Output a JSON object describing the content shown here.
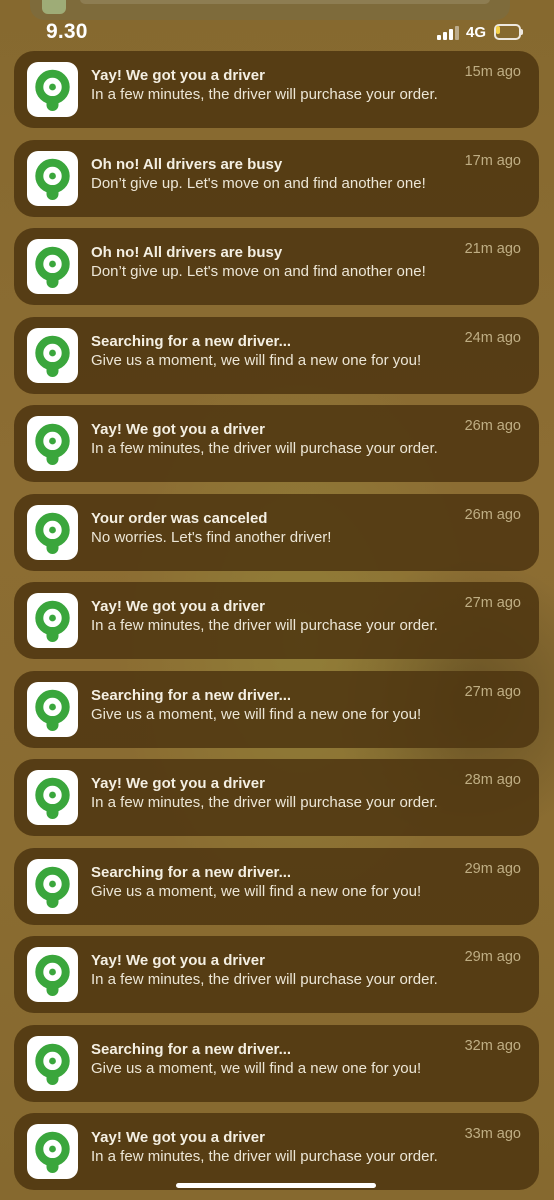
{
  "status_bar": {
    "time": "9.30",
    "network": "4G",
    "signal_bars": 3,
    "battery_level": 0.2,
    "battery_color": "#f4d14a"
  },
  "app": {
    "icon": "gojek-ring-icon",
    "icon_color": "#3aa63c"
  },
  "notifications": [
    {
      "title": "Yay! We got you a driver",
      "body": "In a few minutes, the driver will purchase your order.",
      "time": "15m ago"
    },
    {
      "title": "Oh no! All drivers are busy",
      "body": "Don’t give up. Let's move on and find another one!",
      "time": "17m ago"
    },
    {
      "title": "Oh no! All drivers are busy",
      "body": "Don’t give up. Let's move on and find another one!",
      "time": "21m ago"
    },
    {
      "title": "Searching for a new driver...",
      "body": "Give us a moment, we will find a new one for you!",
      "time": "24m ago"
    },
    {
      "title": "Yay! We got you a driver",
      "body": "In a few minutes, the driver will purchase your order.",
      "time": "26m ago"
    },
    {
      "title": "Your order was canceled",
      "body": "No worries. Let's find another driver!",
      "time": "26m ago"
    },
    {
      "title": "Yay! We got you a driver",
      "body": "In a few minutes, the driver will purchase your order.",
      "time": "27m ago"
    },
    {
      "title": "Searching for a new driver...",
      "body": "Give us a moment, we will find a new one for you!",
      "time": "27m ago"
    },
    {
      "title": "Yay! We got you a driver",
      "body": "In a few minutes, the driver will purchase your order.",
      "time": "28m ago"
    },
    {
      "title": "Searching for a new driver...",
      "body": "Give us a moment, we will find a new one for you!",
      "time": "29m ago"
    },
    {
      "title": "Yay! We got you a driver",
      "body": "In a few minutes, the driver will purchase your order.",
      "time": "29m ago"
    },
    {
      "title": "Searching for a new driver...",
      "body": "Give us a moment, we will find a new one for you!",
      "time": "32m ago"
    },
    {
      "title": "Yay! We got you a driver",
      "body": "In a few minutes, the driver will purchase your order.",
      "time": "33m ago"
    }
  ]
}
